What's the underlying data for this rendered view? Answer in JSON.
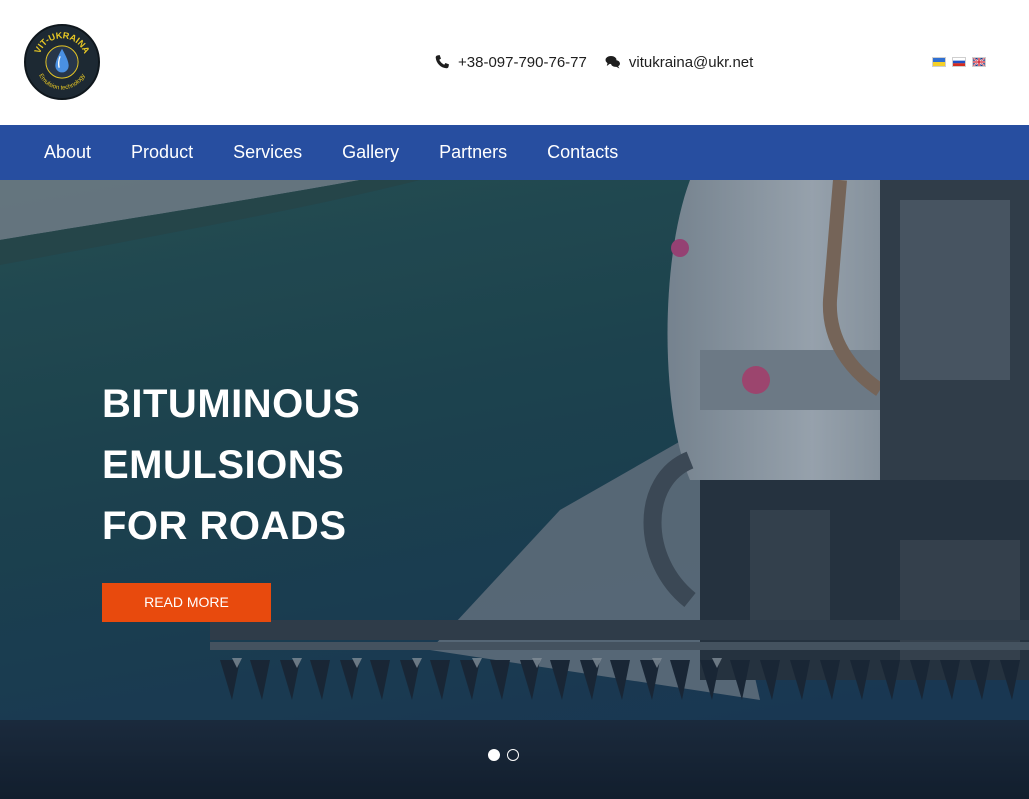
{
  "logo": {
    "text_top": "VIT-UKRAINA",
    "text_bottom": "Emulsion technology",
    "colors": {
      "background": "#1d2933",
      "text": "#e8c824",
      "drop": "#4a90e2"
    }
  },
  "contacts": {
    "phone": {
      "icon": "phone-icon",
      "text": "+38-097-790-76-77"
    },
    "email": {
      "icon": "chat-icon",
      "text": "vitukraina@ukr.net"
    }
  },
  "languages": [
    {
      "code": "ua",
      "icon": "ukraine-flag-icon"
    },
    {
      "code": "ru",
      "icon": "russia-flag-icon"
    },
    {
      "code": "en",
      "icon": "uk-flag-icon"
    }
  ],
  "nav": {
    "items": [
      {
        "label": "About"
      },
      {
        "label": "Product"
      },
      {
        "label": "Services"
      },
      {
        "label": "Gallery"
      },
      {
        "label": "Partners"
      },
      {
        "label": "Contacts"
      }
    ]
  },
  "hero": {
    "title_lines": [
      "BITUMINOUS",
      "EMULSIONS",
      "FOR ROADS"
    ],
    "button_label": "READ MORE",
    "slides_count": 2,
    "active_slide": 1
  },
  "colors": {
    "nav_bg": "#274ea0",
    "button_bg": "#e84a0d",
    "hero_water": "#1f4b4e",
    "hero_shore": "#9aa0a4"
  }
}
